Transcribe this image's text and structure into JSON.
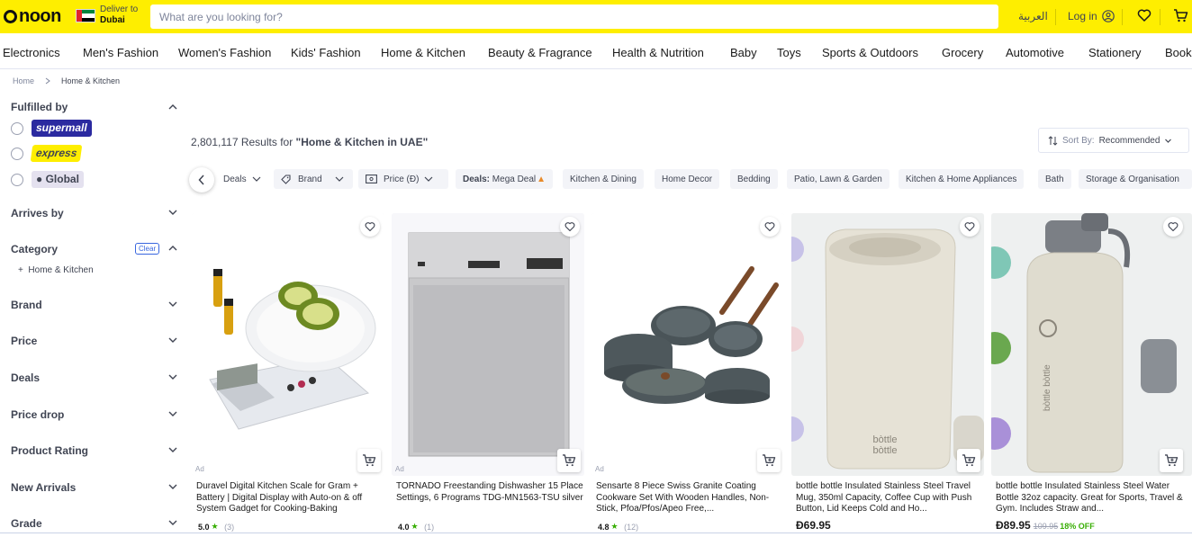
{
  "header": {
    "logo": "noon",
    "deliver_to_label": "Deliver to",
    "deliver_city": "Dubai",
    "search_placeholder": "What are you looking for?",
    "language": "العربية",
    "login": "Log in"
  },
  "nav": [
    "Electronics",
    "Men's Fashion",
    "Women's Fashion",
    "Kids' Fashion",
    "Home & Kitchen",
    "Beauty & Fragrance",
    "Health & Nutrition",
    "Baby",
    "Toys",
    "Sports & Outdoors",
    "Grocery",
    "Automotive",
    "Stationery",
    "Book"
  ],
  "breadcrumb": {
    "home": "Home",
    "current": "Home & Kitchen"
  },
  "sidebar": {
    "fulfilled_by": "Fulfilled by",
    "badges": [
      "supermall",
      "express",
      "Global"
    ],
    "arrives_by": "Arrives by",
    "category": "Category",
    "clear": "Clear",
    "category_item": "Home & Kitchen",
    "brand": "Brand",
    "price": "Price",
    "deals": "Deals",
    "price_drop": "Price drop",
    "product_rating": "Product Rating",
    "new_arrivals": "New Arrivals",
    "grade": "Grade"
  },
  "results": {
    "count": "2,801,117",
    "results_for": "Results for",
    "query": "\"Home & Kitchen in UAE\""
  },
  "sort": {
    "label": "Sort By:",
    "value": "Recommended"
  },
  "chips": {
    "deals": "Deals",
    "brand": "Brand",
    "price": "Price (Đ)",
    "mega_deal_prefix": "Deals:",
    "mega_deal": "Mega Deal",
    "kitchen_dining": "Kitchen & Dining",
    "home_decor": "Home Decor",
    "bedding": "Bedding",
    "patio": "Patio, Lawn & Garden",
    "appliances": "Kitchen & Home Appliances",
    "bath": "Bath",
    "storage": "Storage & Organisation"
  },
  "products": [
    {
      "ad": "Ad",
      "title": "Duravel Digital Kitchen Scale for Gram + Battery | Digital Display with Auto-on & off System Gadget for Cooking-Baking",
      "rating": "5.0",
      "reviews": "(3)"
    },
    {
      "ad": "Ad",
      "title": "TORNADO Freestanding Dishwasher 15 Place Settings, 6 Programs TDG-MN1563-TSU silver",
      "rating": "4.0",
      "reviews": "(1)"
    },
    {
      "ad": "Ad",
      "title": "Sensarte 8 Piece Swiss Granite Coating Cookware Set With Wooden Handles, Non-Stick, Pfoa/Pfos/Apeo Free,...",
      "rating": "4.8",
      "reviews": "(12)"
    },
    {
      "title": "bottle bottle Insulated Stainless Steel Travel Mug, 350ml Capacity, Coffee Cup with Push Button, Lid Keeps Cold and Ho...",
      "currency": "Đ",
      "price": "69.95"
    },
    {
      "title": "bottle bottle Insulated Stainless Steel Water Bottle 32oz capacity. Great for Sports, Travel & Gym. Includes Straw and...",
      "currency": "Đ",
      "price": "89.95",
      "old_price": "109.95",
      "discount": "18% OFF"
    }
  ],
  "colors": {
    "brand_yellow": "#feee00",
    "rating_green": "#38ae04",
    "supermall_blue": "#2b2aa0"
  }
}
